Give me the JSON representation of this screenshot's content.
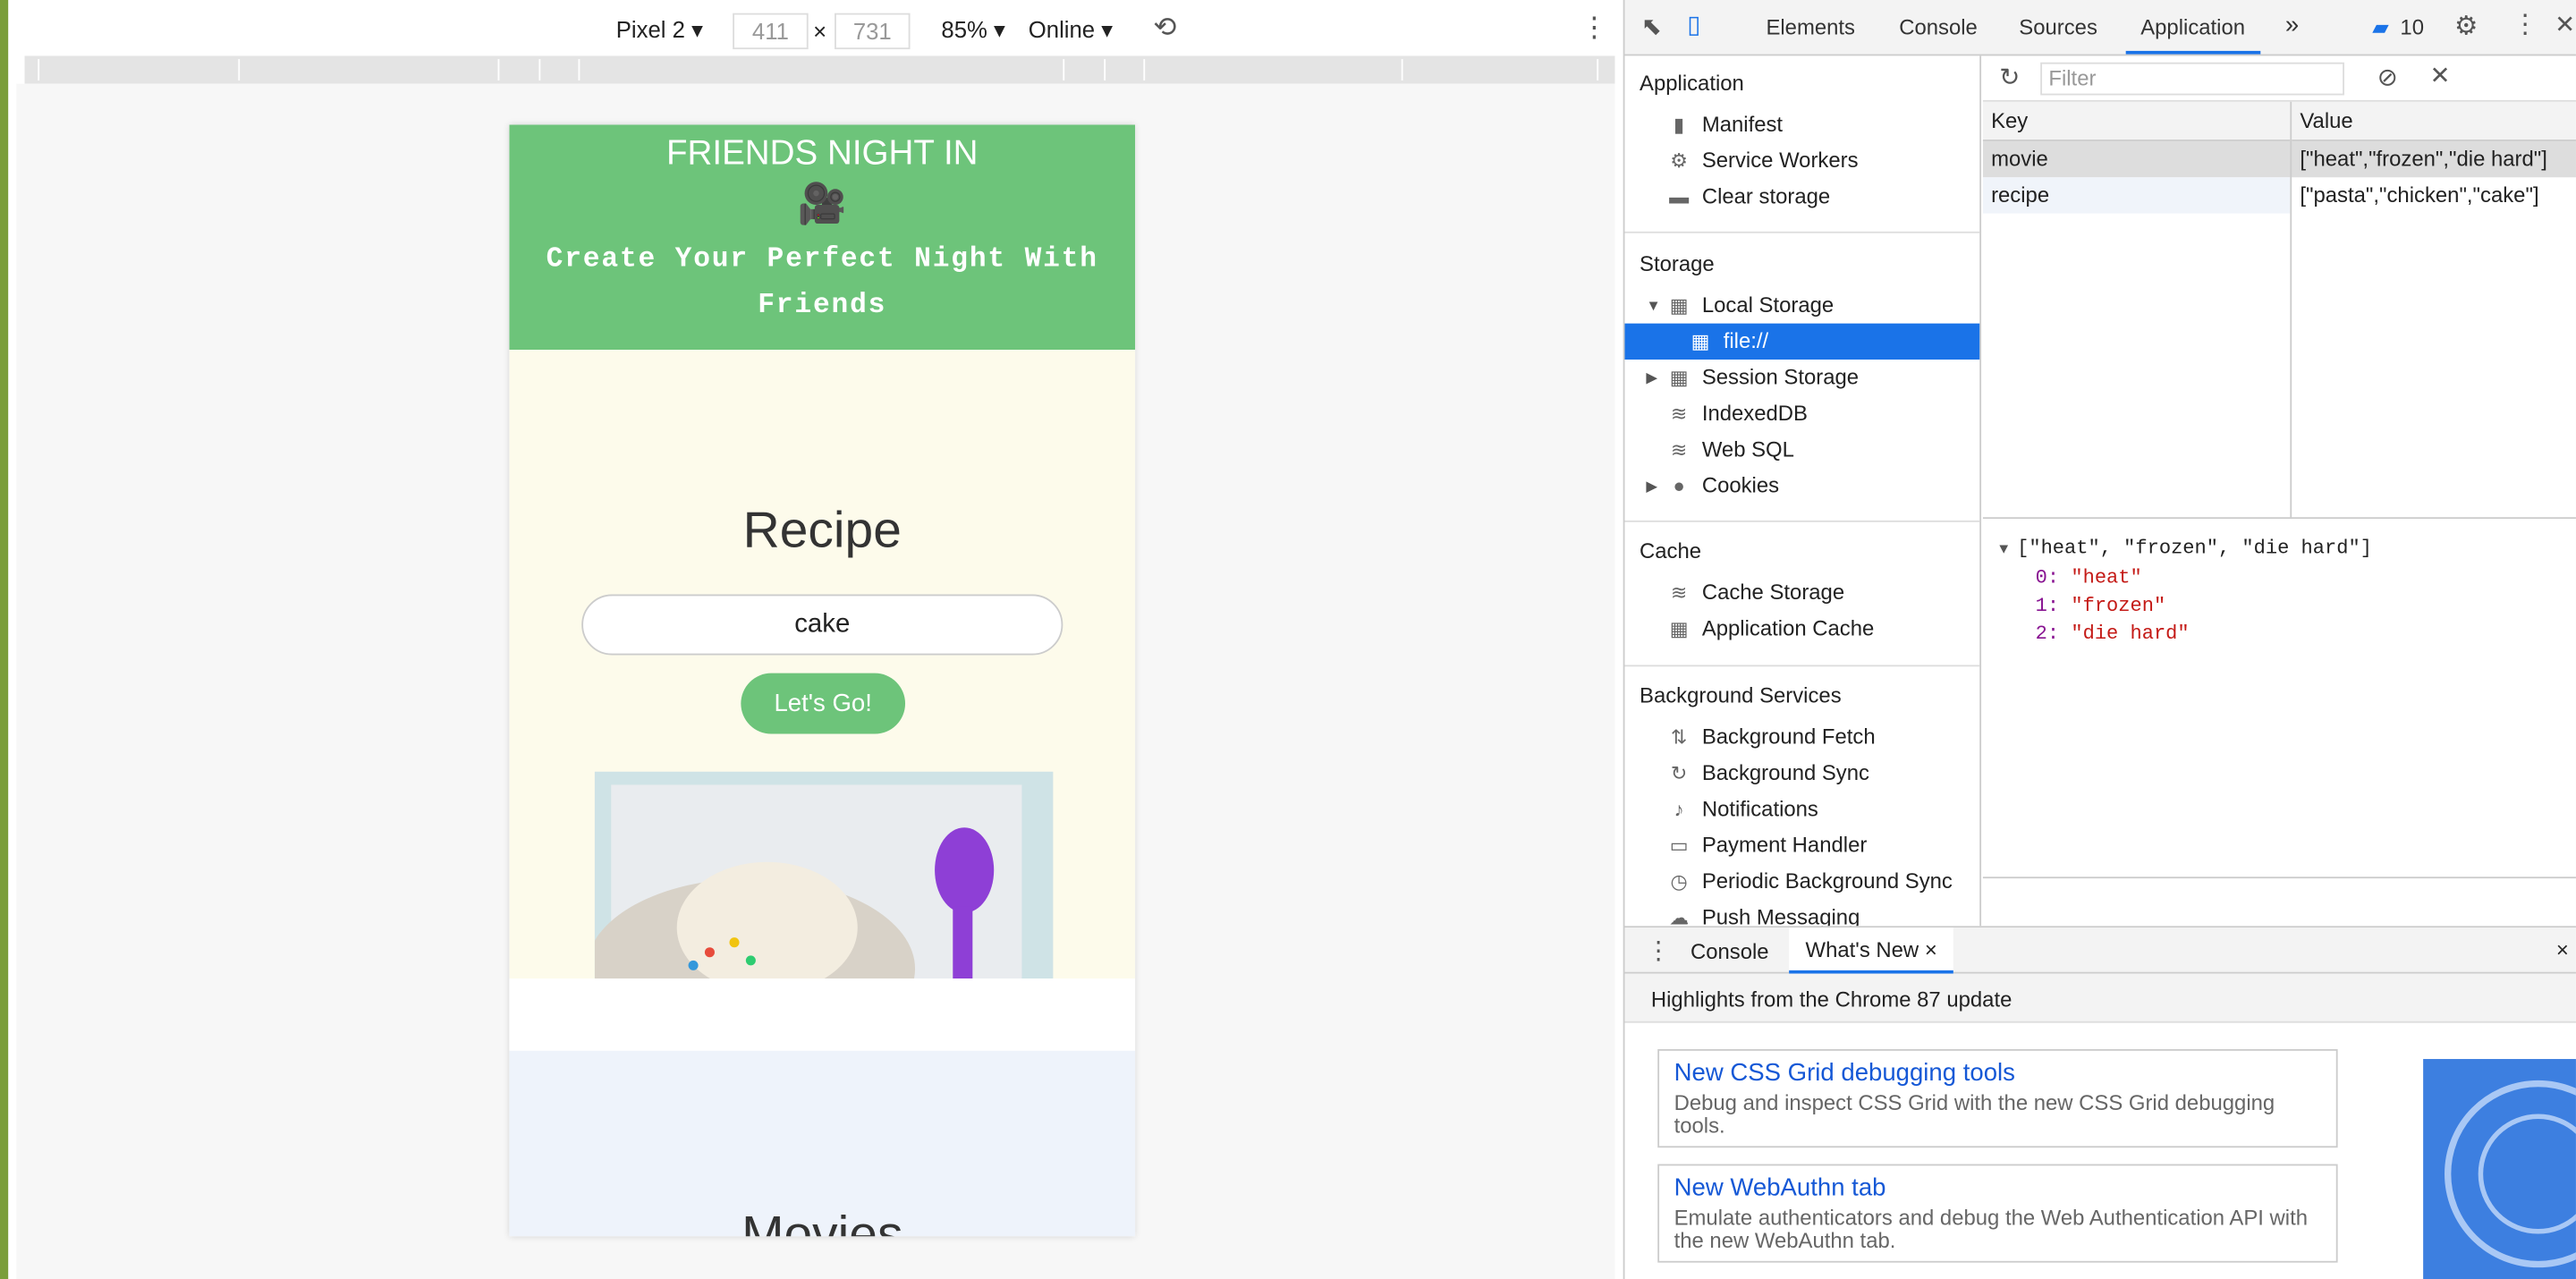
{
  "device_toolbar": {
    "device": "Pixel 2 ▾",
    "width": "411",
    "height": "731",
    "times": "×",
    "zoom": "85% ▾",
    "network": "Online ▾"
  },
  "app": {
    "hero_title": "FRIENDS NIGHT IN",
    "hero_icon": "🎥",
    "hero_subtitle": "Create Your Perfect Night With Friends",
    "recipe_heading": "Recipe",
    "recipe_input": "cake",
    "go_button": "Let's Go!",
    "movies_heading": "Movies"
  },
  "devtools": {
    "tabs": [
      "Elements",
      "Console",
      "Sources",
      "Application"
    ],
    "more": "»",
    "issues_count": "10",
    "sidebar": {
      "application_header": "Application",
      "application_items": [
        "Manifest",
        "Service Workers",
        "Clear storage"
      ],
      "storage_header": "Storage",
      "local_storage": "Local Storage",
      "local_child": "file://",
      "storage_items": [
        "Session Storage",
        "IndexedDB",
        "Web SQL",
        "Cookies"
      ],
      "cache_header": "Cache",
      "cache_items": [
        "Cache Storage",
        "Application Cache"
      ],
      "bg_header": "Background Services",
      "bg_items": [
        "Background Fetch",
        "Background Sync",
        "Notifications",
        "Payment Handler",
        "Periodic Background Sync",
        "Push Messaging"
      ]
    },
    "filter_placeholder": "Filter",
    "table": {
      "col_key": "Key",
      "col_value": "Value",
      "rows": [
        {
          "key": "movie",
          "value": "[\"heat\",\"frozen\",\"die hard\"]"
        },
        {
          "key": "recipe",
          "value": "[\"pasta\",\"chicken\",\"cake\"]"
        }
      ]
    },
    "preview": {
      "summary": "[\"heat\", \"frozen\", \"die hard\"]",
      "items": [
        {
          "k": "0:",
          "v": "\"heat\""
        },
        {
          "k": "1:",
          "v": "\"frozen\""
        },
        {
          "k": "2:",
          "v": "\"die hard\""
        }
      ]
    },
    "drawer": {
      "tab_console": "Console",
      "tab_whatsnew": "What's New",
      "close": "×",
      "highlights": "Highlights from the Chrome 87 update",
      "cards": [
        {
          "title": "New CSS Grid debugging tools",
          "desc": "Debug and inspect CSS Grid with the new CSS Grid debugging tools."
        },
        {
          "title": "New WebAuthn tab",
          "desc": "Emulate authenticators and debug the Web Authentication API with the new WebAuthn tab."
        }
      ]
    }
  }
}
